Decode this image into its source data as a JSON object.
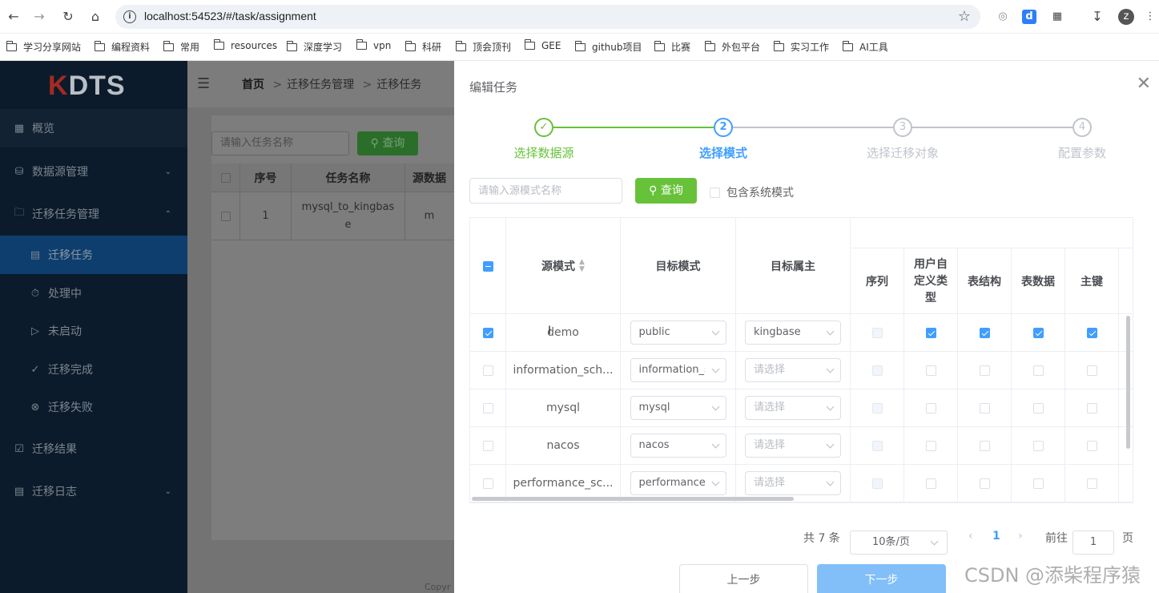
{
  "browser": {
    "url": "localhost:54523/#/task/assignment",
    "bookmarks": [
      "学习分享网站",
      "编程资料",
      "常用",
      "resources",
      "深度学习",
      "vpn",
      "科研",
      "顶会顶刊",
      "GEE",
      "github项目",
      "比赛",
      "外包平台",
      "实习工作",
      "AI工具"
    ],
    "profile_initial": "z"
  },
  "sidebar": {
    "logo_k": "K",
    "logo_rest": "DTS",
    "items": [
      {
        "label": "概览"
      },
      {
        "label": "数据源管理"
      },
      {
        "label": "迁移任务管理"
      },
      {
        "label": "迁移任务"
      },
      {
        "label": "处理中"
      },
      {
        "label": "未启动"
      },
      {
        "label": "迁移完成"
      },
      {
        "label": "迁移失败"
      },
      {
        "label": "迁移结果"
      },
      {
        "label": "迁移日志"
      }
    ]
  },
  "main": {
    "breadcrumb": [
      "首页",
      "迁移任务管理",
      "迁移任务"
    ],
    "search_placeholder": "请输入任务名称",
    "search_button": "查询",
    "table_headers": [
      "序号",
      "任务名称",
      "源数据"
    ],
    "rows": [
      {
        "index": "1",
        "name": "mysql_to_kingbase",
        "source": "m"
      }
    ],
    "copyright": "Copyr"
  },
  "drawer": {
    "title": "编辑任务",
    "steps": [
      {
        "number": "1",
        "label": "选择数据源",
        "status": "done"
      },
      {
        "number": "2",
        "label": "选择模式",
        "status": "active"
      },
      {
        "number": "3",
        "label": "选择迁移对象",
        "status": "wait"
      },
      {
        "number": "4",
        "label": "配置参数",
        "status": "wait"
      }
    ],
    "search_placeholder": "请输入源模式名称",
    "search_button": "查询",
    "include_system": "包含系统模式",
    "columns": {
      "source": "源模式",
      "target": "目标模式",
      "owner": "目标属主",
      "seq": "序列",
      "udt": "用户自定义类型",
      "struct": "表结构",
      "data": "表数据",
      "pk": "主键"
    },
    "rows": [
      {
        "checked": true,
        "source": "demo",
        "target": "public",
        "owner": "kingbase",
        "owner_placeholder": false,
        "seq": false,
        "udt": true,
        "struct": true,
        "data": true,
        "pk": true
      },
      {
        "checked": false,
        "source": "information_sch...",
        "target": "information_s",
        "owner": "请选择",
        "owner_placeholder": true,
        "seq": false,
        "udt": false,
        "struct": false,
        "data": false,
        "pk": false
      },
      {
        "checked": false,
        "source": "mysql",
        "target": "mysql",
        "owner": "请选择",
        "owner_placeholder": true,
        "seq": false,
        "udt": false,
        "struct": false,
        "data": false,
        "pk": false
      },
      {
        "checked": false,
        "source": "nacos",
        "target": "nacos",
        "owner": "请选择",
        "owner_placeholder": true,
        "seq": false,
        "udt": false,
        "struct": false,
        "data": false,
        "pk": false
      },
      {
        "checked": false,
        "source": "performance_sc...",
        "target": "performance_",
        "owner": "请选择",
        "owner_placeholder": true,
        "seq": false,
        "udt": false,
        "struct": false,
        "data": false,
        "pk": false
      }
    ],
    "pagination": {
      "total": "共 7 条",
      "page_size": "10条/页",
      "current": "1",
      "goto_label": "前往",
      "goto_value": "1",
      "page_unit": "页"
    },
    "prev_button": "上一步",
    "next_button": "下一步"
  },
  "watermark": "CSDN @添柴程序猿",
  "colors": {
    "primary": "#409eff",
    "success": "#67c23a",
    "sidebar": "#0c1b2b",
    "next_disabled": "#82bff9"
  }
}
